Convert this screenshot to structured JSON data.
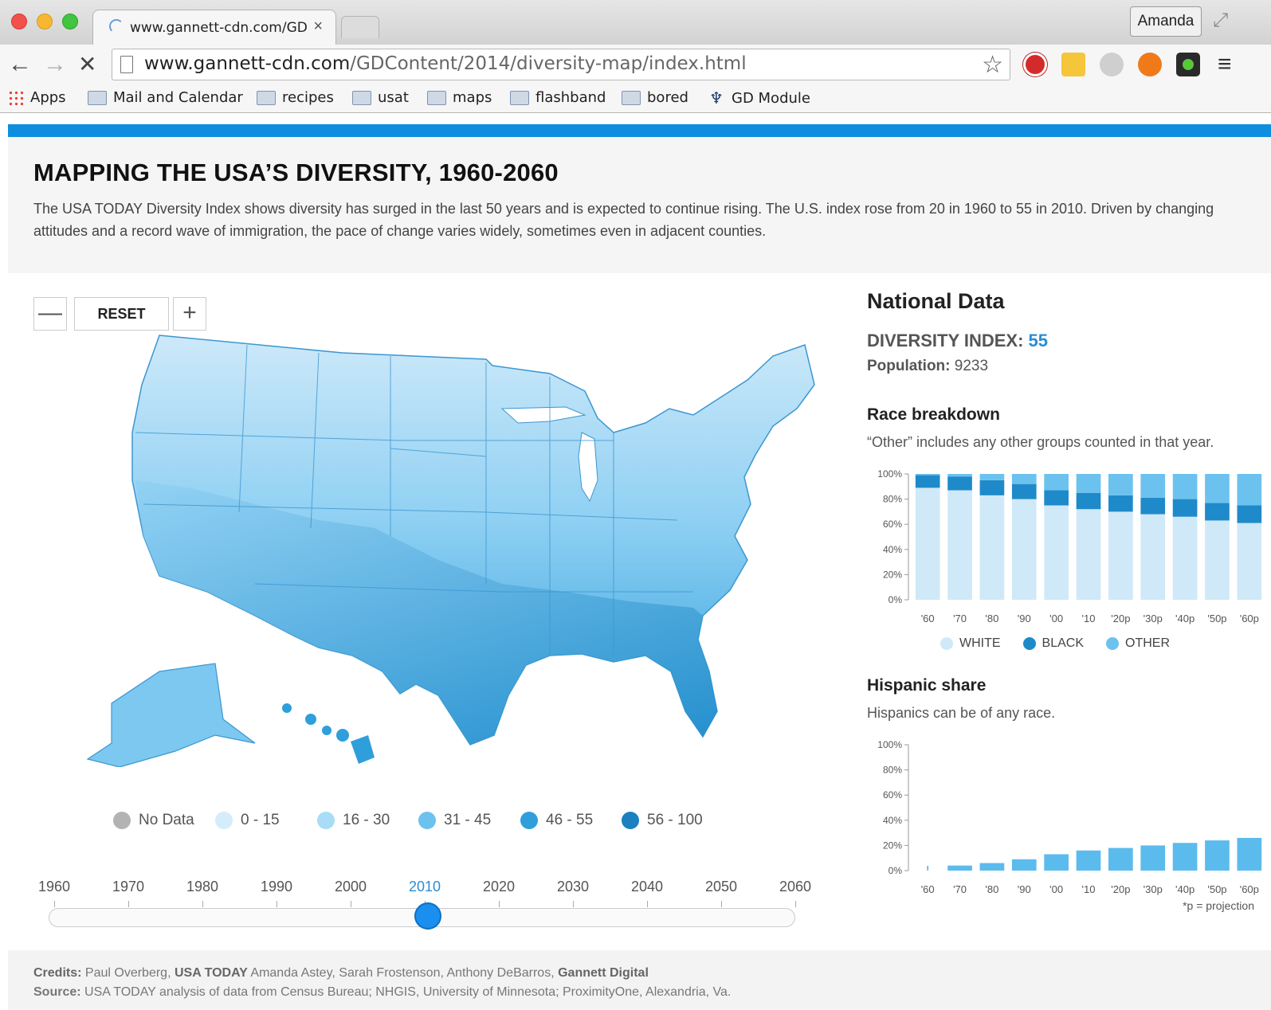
{
  "browser": {
    "tab_title": "www.gannett-cdn.com/GD",
    "tab_close": "×",
    "profile": "Amanda",
    "url_host": "www.gannett-cdn.com",
    "url_path": "/GDContent/2014/diversity-map/index.html",
    "bookmarks": [
      "Apps",
      "Mail and Calendar",
      "recipes",
      "usat",
      "maps",
      "flashband",
      "bored",
      "GD Module"
    ]
  },
  "header": {
    "title": "MAPPING THE USA’S DIVERSITY, 1960-2060",
    "description": "The USA TODAY Diversity Index shows diversity has surged in the last 50 years and is expected to continue rising. The U.S. index rose from 20 in 1960 to 55 in 2010. Driven by changing attitudes and a record wave of immigration, the pace of change varies widely, sometimes even in adjacent counties."
  },
  "map_controls": {
    "zoom_out": "—",
    "reset": "RESET",
    "zoom_in": "+"
  },
  "map_legend": [
    {
      "label": "No Data",
      "color": "#b3b3b3"
    },
    {
      "label": "0 - 15",
      "color": "#d5ecfa"
    },
    {
      "label": "16 - 30",
      "color": "#a9dcf6"
    },
    {
      "label": "31 - 45",
      "color": "#6cc2ef"
    },
    {
      "label": "46 - 55",
      "color": "#2e9fdb"
    },
    {
      "label": "56 - 100",
      "color": "#1b80c0"
    }
  ],
  "timeline": {
    "years": [
      "1960",
      "1970",
      "1980",
      "1990",
      "2000",
      "2010",
      "2020",
      "2030",
      "2040",
      "2050",
      "2060"
    ],
    "selected_year": "2010"
  },
  "national": {
    "title": "National Data",
    "index_label": "DIVERSITY INDEX:",
    "index_value": "55",
    "population_label": "Population:",
    "population_value": "9233"
  },
  "race": {
    "title": "Race breakdown",
    "note": "“Other” includes any other groups counted in that year.",
    "legend": [
      {
        "label": "WHITE",
        "color": "#cfe9f8"
      },
      {
        "label": "BLACK",
        "color": "#1f8ac9"
      },
      {
        "label": "OTHER",
        "color": "#6cc2ef"
      }
    ]
  },
  "hispanic": {
    "title": "Hispanic share",
    "note": "Hispanics can be of any race.",
    "footnote": "*p = projection"
  },
  "chart_data": [
    {
      "type": "bar",
      "stacked": true,
      "categories": [
        "'60",
        "'70",
        "'80",
        "'90",
        "'00",
        "'10",
        "'20p",
        "'30p",
        "'40p",
        "'50p",
        "'60p"
      ],
      "series": [
        {
          "name": "WHITE",
          "values": [
            89,
            87,
            83,
            80,
            75,
            72,
            70,
            68,
            66,
            63,
            61
          ]
        },
        {
          "name": "BLACK",
          "values": [
            10,
            11,
            12,
            12,
            12,
            13,
            13,
            13,
            14,
            14,
            14
          ]
        },
        {
          "name": "OTHER",
          "values": [
            1,
            2,
            5,
            8,
            13,
            15,
            17,
            19,
            20,
            23,
            25
          ]
        }
      ],
      "yticks": [
        "0%",
        "20%",
        "40%",
        "60%",
        "80%",
        "100%"
      ],
      "ylim": [
        0,
        100
      ],
      "legend_position": "bottom"
    },
    {
      "type": "bar",
      "categories": [
        "'60",
        "'70",
        "'80",
        "'90",
        "'00",
        "'10",
        "'20p",
        "'30p",
        "'40p",
        "'50p",
        "'60p"
      ],
      "series": [
        {
          "values": [
            0,
            4,
            6,
            9,
            13,
            16,
            18,
            20,
            22,
            24,
            26
          ]
        }
      ],
      "yticks": [
        "0%",
        "20%",
        "40%",
        "60%",
        "80%",
        "100%"
      ],
      "ylim": [
        0,
        100
      ]
    }
  ],
  "credits": {
    "label": "Credits:",
    "text_1": "Paul Overberg,",
    "org_1": "USA TODAY",
    "text_2": "Amanda Astey, Sarah Frostenson, Anthony DeBarros,",
    "org_2": "Gannett Digital",
    "source_label": "Source:",
    "source_text": "USA TODAY analysis of data from Census Bureau; NHGIS, University of Minnesota; ProximityOne, Alexandria, Va."
  }
}
